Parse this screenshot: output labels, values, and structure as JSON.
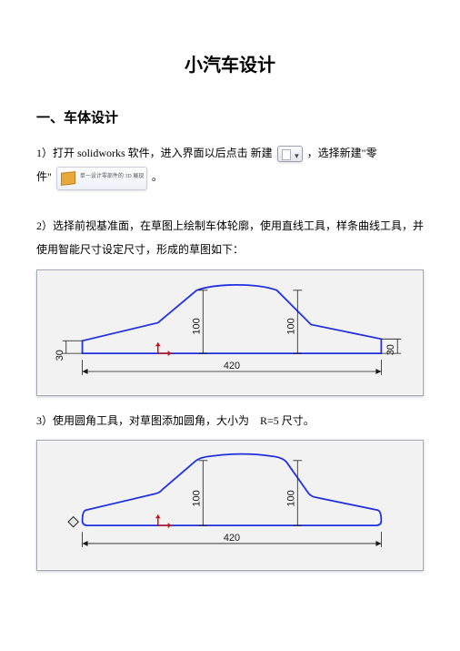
{
  "title": "小汽车设计",
  "section1_head": "一、车体设计",
  "step1_pre": "1）打开 solidworks 软件，进入界面以后点击 新建",
  "step1_mid": "，选择新建\"零",
  "step1_line2a": "件\"",
  "step1_line2b": "。",
  "step2": "2）选择前视基准面，在草图上绘制车体轮廓，使用直线工具，样条曲线工具，并使用智能尺寸设定尺寸，形成的草图如下：",
  "step3_text": "3）使用圆角工具，对草图添加圆角，大小为",
  "step3_radius": "R=5 尺寸。",
  "dims": {
    "left": "30",
    "right": "30",
    "mid1": "100",
    "mid2": "100",
    "bottom": "420"
  }
}
